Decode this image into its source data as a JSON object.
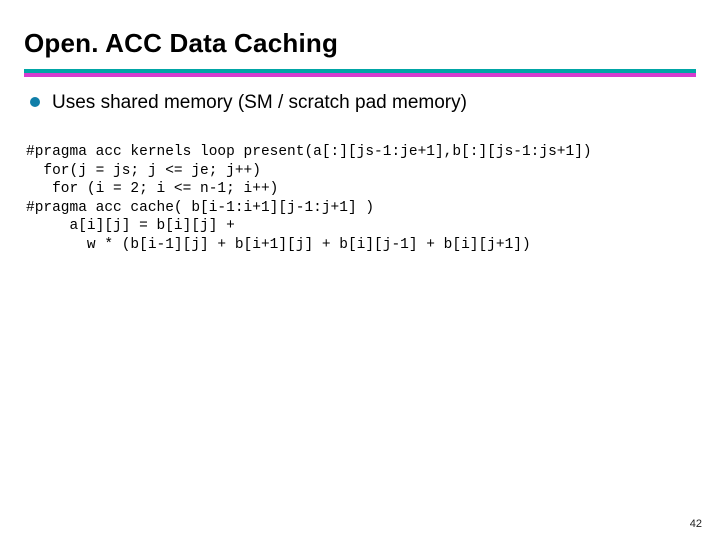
{
  "title": "Open. ACC Data Caching",
  "bullets": [
    {
      "text": "Uses shared memory (SM / scratch pad memory)"
    }
  ],
  "code_lines": [
    "#pragma acc kernels loop present(a[:][js-1:je+1],b[:][js-1:js+1])",
    "  for(j = js; j <= je; j++)",
    "   for (i = 2; i <= n-1; i++)",
    "#pragma acc cache( b[i-1:i+1][j-1:j+1] )",
    "     a[i][j] = b[i][j] +",
    "       w * (b[i-1][j] + b[i+1][j] + b[i][j-1] + b[i][j+1])"
  ],
  "page_number": "42"
}
